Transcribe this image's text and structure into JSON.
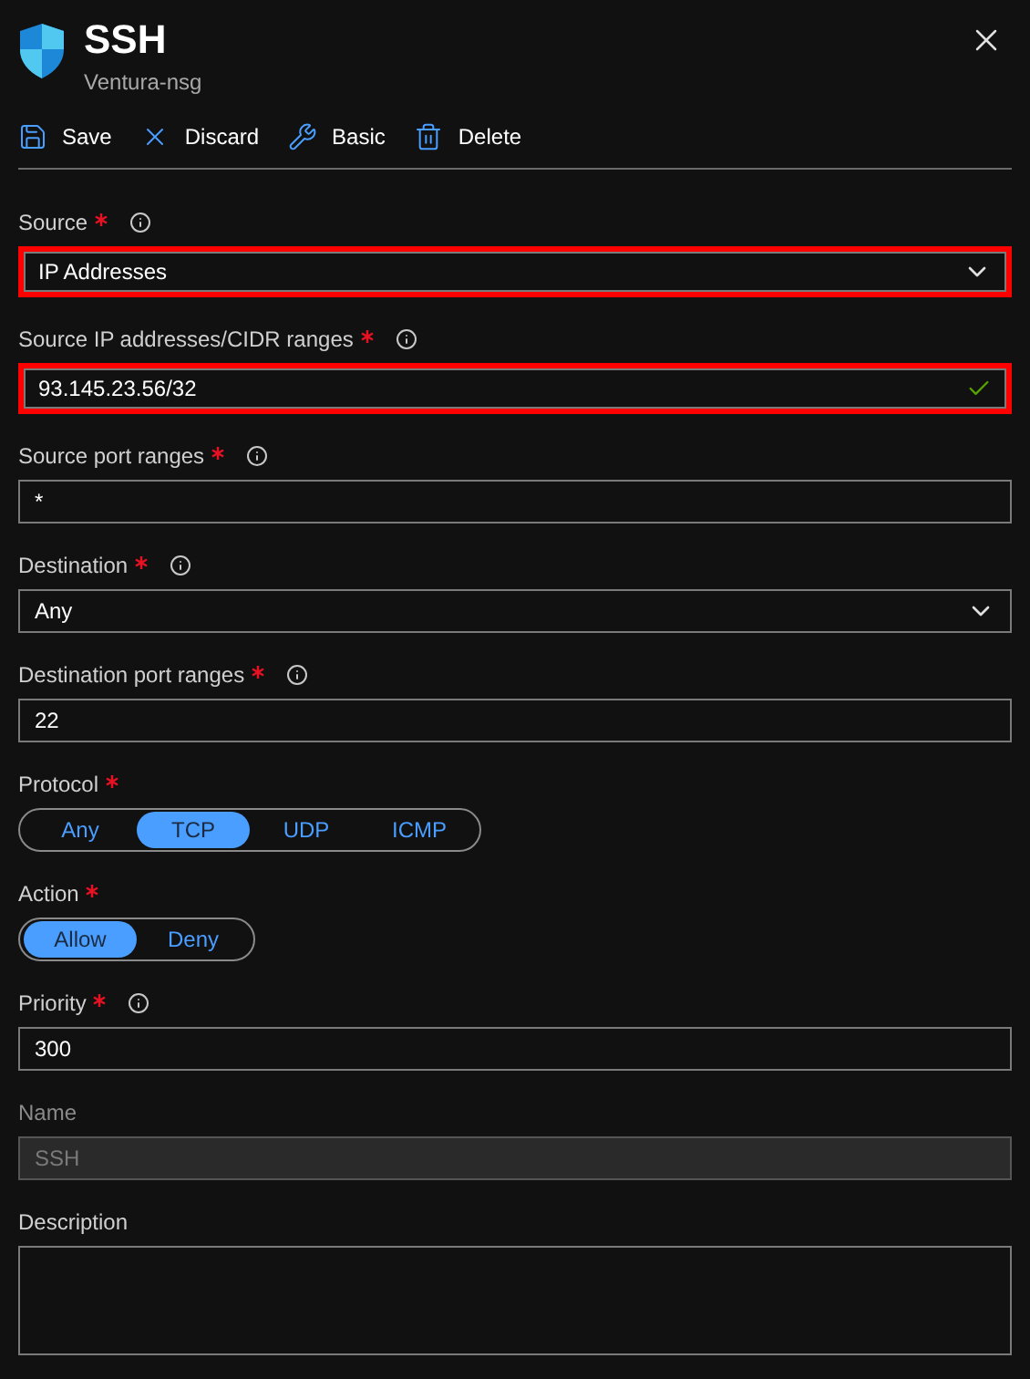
{
  "header": {
    "title": "SSH",
    "subtitle": "Ventura-nsg"
  },
  "toolbar": [
    {
      "kind": "save",
      "label": "Save"
    },
    {
      "kind": "discard",
      "label": "Discard"
    },
    {
      "kind": "basic",
      "label": "Basic"
    },
    {
      "kind": "delete",
      "label": "Delete"
    }
  ],
  "fields": [
    {
      "kind": "select",
      "label": "Source",
      "required": true,
      "info": true,
      "value": "IP Addresses",
      "highlighted": true
    },
    {
      "kind": "text",
      "label": "Source IP addresses/CIDR ranges",
      "required": true,
      "info": true,
      "value": "93.145.23.56/32",
      "highlighted": true,
      "valid": true
    },
    {
      "kind": "text",
      "label": "Source port ranges",
      "required": true,
      "info": true,
      "value": "*",
      "highlighted": false
    },
    {
      "kind": "select",
      "label": "Destination",
      "required": true,
      "info": true,
      "value": "Any",
      "highlighted": false
    },
    {
      "kind": "text",
      "label": "Destination port ranges",
      "required": true,
      "info": true,
      "value": "22",
      "highlighted": false
    },
    {
      "kind": "toggle",
      "label": "Protocol",
      "required": true,
      "options": [
        {
          "label": "Any",
          "selected": false
        },
        {
          "label": "TCP",
          "selected": true
        },
        {
          "label": "UDP",
          "selected": false
        },
        {
          "label": "ICMP",
          "selected": false
        }
      ]
    },
    {
      "kind": "toggle",
      "label": "Action",
      "required": true,
      "options": [
        {
          "label": "Allow",
          "selected": true
        },
        {
          "label": "Deny",
          "selected": false
        }
      ]
    },
    {
      "kind": "text",
      "label": "Priority",
      "required": true,
      "info": true,
      "value": "300",
      "highlighted": false
    },
    {
      "kind": "text",
      "label": "Name",
      "required": false,
      "info": false,
      "value": "SSH",
      "highlighted": false,
      "disabled": true
    },
    {
      "kind": "textarea",
      "label": "Description",
      "required": false,
      "info": false
    }
  ]
}
